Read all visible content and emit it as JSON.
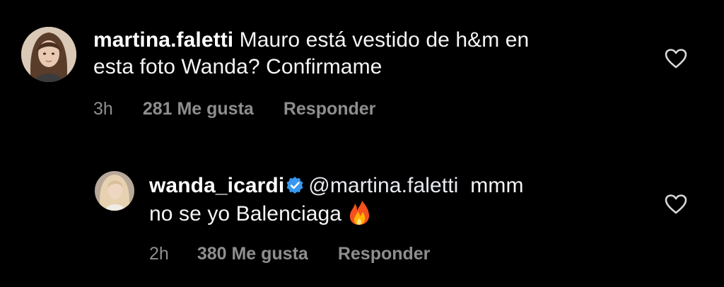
{
  "comments": [
    {
      "username": "martina.faletti",
      "text_line1": "Mauro está vestido de h&m en",
      "text_line2": "esta foto Wanda? Confirmame",
      "time": "3h",
      "likes": "281 Me gusta",
      "reply_label": "Responder",
      "avatar_icon": "profile-photo-woman-dark-hair",
      "heart_icon": "heart-outline-icon"
    },
    {
      "username": "wanda_icardi",
      "verified_icon": "verified-badge-icon",
      "mention": "@martina.faletti",
      "text_after_mention": "mmm",
      "text_line2": "no se yo Balenciaga",
      "emoji": "🔥",
      "time": "2h",
      "likes": "380 Me gusta",
      "reply_label": "Responder",
      "avatar_icon": "profile-photo-woman-blonde-hair",
      "heart_icon": "heart-outline-icon"
    }
  ],
  "colors": {
    "background": "#000000",
    "text": "#f5f5f5",
    "meta": "#8e8e8e",
    "verified": "#3897f0",
    "heart_stroke": "#d8d8d8"
  }
}
